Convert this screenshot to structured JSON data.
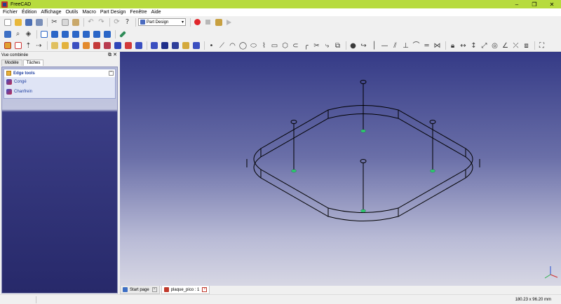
{
  "window": {
    "title": "FreeCAD",
    "controls": {
      "minimize": "–",
      "maximize": "❐",
      "close": "✕"
    }
  },
  "menubar": [
    "Fichier",
    "Édition",
    "Affichage",
    "Outils",
    "Macro",
    "Part Design",
    "Fenêtre",
    "Aide"
  ],
  "toolbar": {
    "workbench": "Part Design"
  },
  "combo_view": {
    "title": "Vue combinée",
    "tabs": [
      "Modèle",
      "Tâches"
    ],
    "active_tab": "Tâches",
    "task_panel": {
      "title": "Edge tools",
      "items": [
        "Congé",
        "Chanfrein"
      ]
    }
  },
  "document_tabs": [
    {
      "label": "Start page",
      "close": "×"
    },
    {
      "label": "plaque_pico : 1",
      "close": "×"
    }
  ],
  "status": {
    "dimensions": "180.23 x 96.20 mm"
  },
  "colors": {
    "titlebar": "#b7db3e",
    "viewport_top": "#343a86",
    "viewport_bottom": "#d7d7e4",
    "vertex_green": "#2ecc71"
  }
}
